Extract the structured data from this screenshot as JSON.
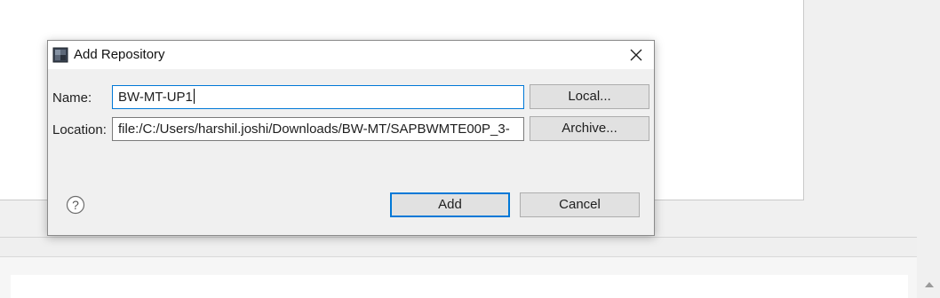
{
  "dialog": {
    "title": "Add Repository",
    "close_icon": "close-icon",
    "app_icon": "repository-icon",
    "name_label": "Name:",
    "name_value": "BW-MT-UP1",
    "location_label": "Location:",
    "location_value": "file:/C:/Users/harshil.joshi/Downloads/BW-MT/SAPBWMTE00P_3-",
    "local_button": "Local...",
    "archive_button": "Archive...",
    "add_button": "Add",
    "cancel_button": "Cancel",
    "help_icon": "help-icon"
  },
  "colors": {
    "focus_accent": "#0078d7",
    "dialog_bg": "#f0f0f0",
    "button_bg": "#e1e1e1"
  }
}
